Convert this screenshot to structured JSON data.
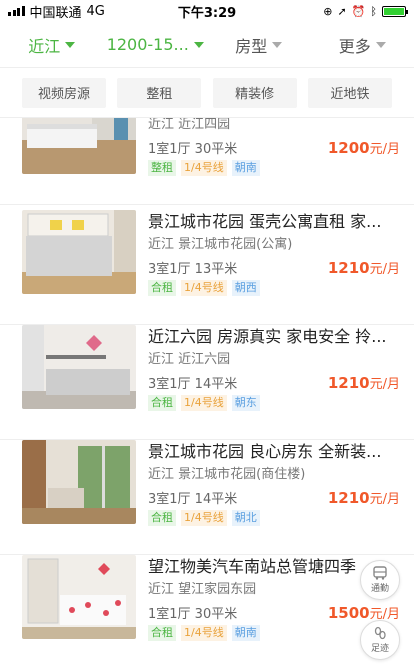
{
  "status_bar": {
    "carrier": "中国联通",
    "network": "4G",
    "time": "下午3:29"
  },
  "filters": [
    {
      "label": "近江",
      "active": true
    },
    {
      "label": "1200-15...",
      "active": true
    },
    {
      "label": "房型",
      "active": false
    },
    {
      "label": "更多",
      "active": false
    }
  ],
  "quick_tags": [
    "视频房源",
    "整租",
    "精装修",
    "近地铁"
  ],
  "listings": [
    {
      "title": "",
      "location": "近江 近江四园",
      "rooms": "1室1厅 30平米",
      "price": "1200",
      "unit": "元/月",
      "tags": [
        {
          "text": "整租",
          "color": "green"
        },
        {
          "text": "1/4号线",
          "color": "orange"
        },
        {
          "text": "朝南",
          "color": "blue"
        }
      ]
    },
    {
      "title": "景江城市花园 蛋壳公寓直租 家...",
      "location": "近江 景江城市花园(公寓)",
      "rooms": "3室1厅 13平米",
      "price": "1210",
      "unit": "元/月",
      "tags": [
        {
          "text": "合租",
          "color": "green"
        },
        {
          "text": "1/4号线",
          "color": "orange"
        },
        {
          "text": "朝西",
          "color": "blue"
        }
      ]
    },
    {
      "title": "近江六园 房源真实 家电安全 拎...",
      "location": "近江 近江六园",
      "rooms": "3室1厅 14平米",
      "price": "1210",
      "unit": "元/月",
      "tags": [
        {
          "text": "合租",
          "color": "green"
        },
        {
          "text": "1/4号线",
          "color": "orange"
        },
        {
          "text": "朝东",
          "color": "blue"
        }
      ]
    },
    {
      "title": "景江城市花园 良心房东 全新装...",
      "location": "近江 景江城市花园(商住楼)",
      "rooms": "3室1厅 14平米",
      "price": "1210",
      "unit": "元/月",
      "tags": [
        {
          "text": "合租",
          "color": "green"
        },
        {
          "text": "1/4号线",
          "color": "orange"
        },
        {
          "text": "朝北",
          "color": "blue"
        }
      ]
    },
    {
      "title": "望江物美汽车南站总管塘四季",
      "location": "近江 望江家园东园",
      "rooms": "1室1厅 30平米",
      "price": "1500",
      "unit": "元/月",
      "tags": [
        {
          "text": "合租",
          "color": "green"
        },
        {
          "text": "1/4号线",
          "color": "orange"
        },
        {
          "text": "朝南",
          "color": "blue"
        }
      ]
    }
  ],
  "float_buttons": {
    "commute": "通勤",
    "footprint": "足迹"
  },
  "colors": {
    "accent": "#4cb543",
    "price": "#f0582a"
  }
}
